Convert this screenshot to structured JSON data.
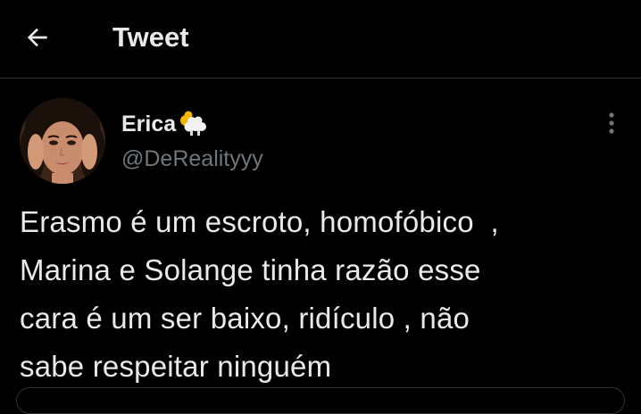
{
  "header": {
    "back_icon": "arrow-left-icon",
    "title": "Tweet"
  },
  "tweet": {
    "author_name": "Erica",
    "name_emoji": "sheep-cloud-emoji",
    "author_handle": "@DeRealityyy",
    "menu_icon": "vertical-dots-icon",
    "text": "Erasmo é um escroto, homofóbico  ,\nMarina e Solange tinha razão esse\ncara é um ser baixo, ridículo , não\nsabe respeitar ninguém"
  },
  "colors": {
    "background": "#000000",
    "text_primary": "#e7e9ea",
    "text_secondary": "#71767b",
    "divider": "#2f3336"
  }
}
